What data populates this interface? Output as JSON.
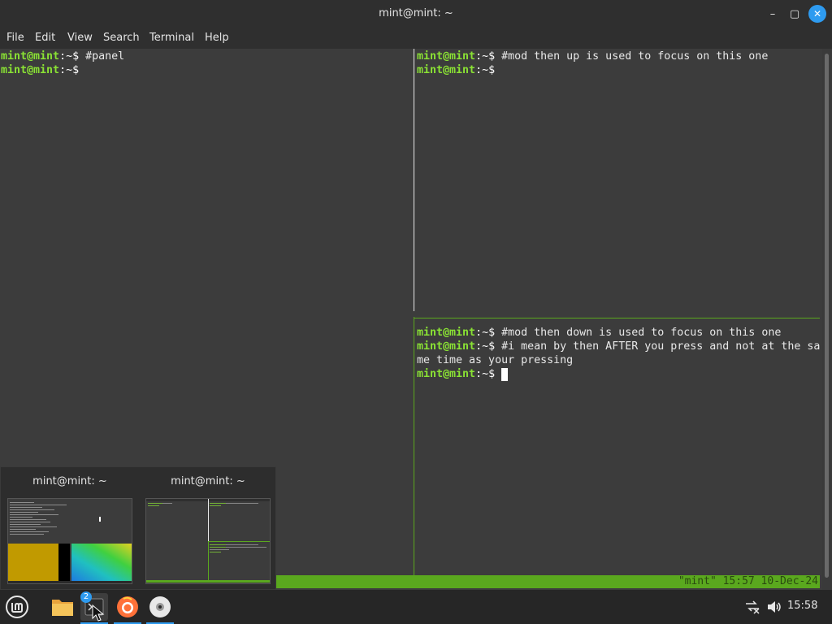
{
  "window": {
    "title": "mint@mint: ~",
    "minimize_icon": "minimize-icon",
    "maximize_icon": "maximize-icon",
    "close_icon": "close-icon"
  },
  "menu": [
    "File",
    "Edit",
    "View",
    "Search",
    "Terminal",
    "Help"
  ],
  "prompt": {
    "user": "mint@mint",
    "sep": ":",
    "path": "~$"
  },
  "panes": {
    "left": {
      "lines": [
        " #panel",
        ""
      ]
    },
    "top_right": {
      "lines": [
        " #mod then up is used to focus on this one",
        ""
      ]
    },
    "bottom_right": {
      "line1": " #mod then down is used to focus on this one",
      "line2": " #i mean by then AFTER you press and not at the sa",
      "line2_wrap": "me time as your pressing",
      "line3": " "
    }
  },
  "status_bar": {
    "text": "\"mint\" 15:57 10-Dec-24"
  },
  "window_preview": {
    "items": [
      {
        "title": "mint@mint: ~"
      },
      {
        "title": "mint@mint: ~"
      }
    ]
  },
  "taskbar": {
    "menu_icon": "mint-menu-icon",
    "apps": [
      {
        "icon": "folder-icon"
      },
      {
        "icon": "terminal-icon",
        "badge": "2"
      },
      {
        "icon": "firefox-icon"
      },
      {
        "icon": "disc-icon"
      }
    ],
    "tray": {
      "network_icon": "network-disconnected-icon",
      "volume_icon": "volume-icon",
      "clock": "15:58"
    }
  },
  "colors": {
    "prompt": "#8ae234",
    "status_bar": "#5aa81e",
    "accent": "#2e9bf0"
  }
}
